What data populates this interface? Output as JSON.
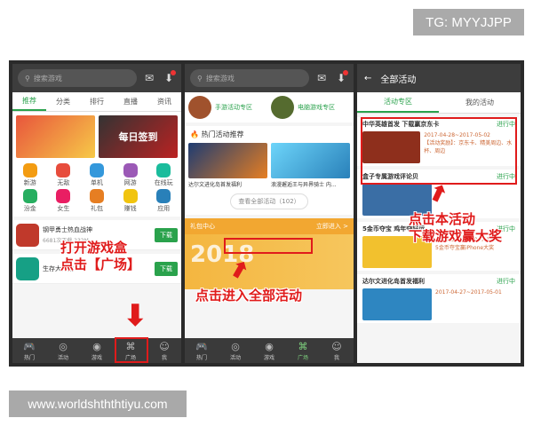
{
  "watermark_top": "TG: MYYJJPP",
  "watermark_bottom": "www.worldshththtiyu.com",
  "p1": {
    "search_placeholder": "搜索游戏",
    "tabs": [
      "推荐",
      "分类",
      "排行",
      "直播",
      "资讯"
    ],
    "banner2_text": "每日签到",
    "grid": [
      {
        "label": "新游",
        "color": "#f39c12"
      },
      {
        "label": "无敌",
        "color": "#e74c3c"
      },
      {
        "label": "单机",
        "color": "#3498db"
      },
      {
        "label": "网游",
        "color": "#9b59b6"
      },
      {
        "label": "在线玩",
        "color": "#1abc9c"
      },
      {
        "label": "汾金",
        "color": "#27ae60"
      },
      {
        "label": "女生",
        "color": "#e91e63"
      },
      {
        "label": "礼包",
        "color": "#e67e22"
      },
      {
        "label": "赚钱",
        "color": "#f1c40f"
      },
      {
        "label": "应用",
        "color": "#2980b9"
      }
    ],
    "rows": [
      {
        "name": "钢甲勇士热血战神",
        "meta": "6681次下载 232M",
        "btn": "下载",
        "color": "#c0392b"
      },
      {
        "name": "生存大作战",
        "meta": "",
        "btn": "下载",
        "color": "#16a085"
      }
    ],
    "nav": [
      "热门",
      "活动",
      "游戏",
      "广场",
      "我"
    ],
    "anno": [
      "打开游戏盒",
      "点击【广场】"
    ]
  },
  "p2": {
    "search_placeholder": "搜索游戏",
    "zones": [
      "手游活动专区",
      "电脑游戏专区"
    ],
    "section": "热门活动推荐",
    "cards": [
      "达尔文进化岛首发福利",
      "浪漫邂逅王与异界骑士 内..."
    ],
    "view_all": "查看全部活动（102）",
    "gift_title": "礼包中心",
    "gift_link": "立即进入 >",
    "gift_big": "2018",
    "nav": [
      "热门",
      "活动",
      "游戏",
      "广场",
      "我"
    ],
    "anno": "点击进入全部活动"
  },
  "p3": {
    "title": "全部活动",
    "tabs": [
      "活动专区",
      "我的活动"
    ],
    "activities": [
      {
        "title": "中华英雄首发 下载赢京东卡",
        "status": "进行中",
        "date": "2017-04-28~2017-05-02",
        "desc": "【活动奖励】：京东卡、精美周边、水杯、周边",
        "color": "#8e2f1c"
      },
      {
        "title": "盒子专属游戏评论贝",
        "status": "进行中",
        "date": "",
        "desc": "",
        "color": "#3a6ea5"
      },
      {
        "title": "5金币夺宝 鸡年夺好运",
        "status": "进行中",
        "date": "2015-11-09~2017-12-30",
        "desc": "5金币夺宝赢iPhone大奖",
        "color": "#f2c12e"
      },
      {
        "title": "达尔文进化岛首发福利",
        "status": "进行中",
        "date": "2017-04-27~2017-05-01",
        "desc": "",
        "color": "#2e86c1"
      }
    ],
    "anno": [
      "点击本活动",
      "下载游戏赢大奖"
    ]
  }
}
